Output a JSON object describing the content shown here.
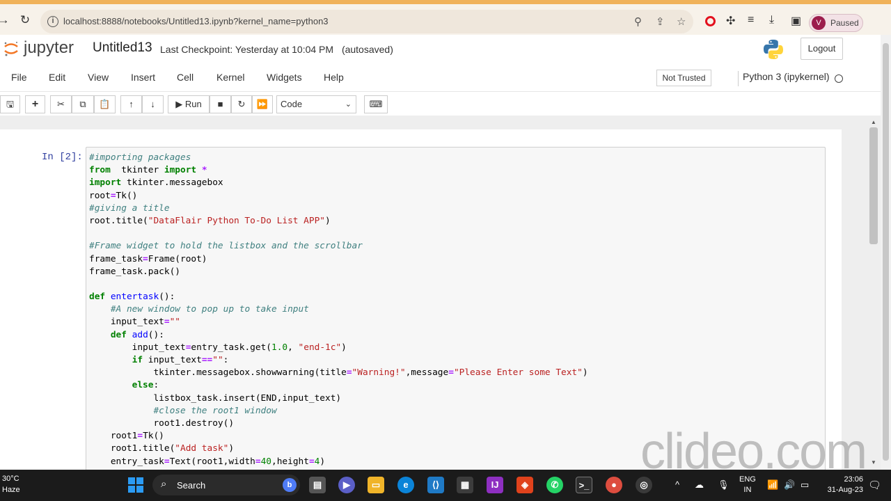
{
  "browser": {
    "url": "localhost:8888/notebooks/Untitled13.ipynb?kernel_name=python3",
    "profile_initial": "V",
    "profile_status": "Paused"
  },
  "header": {
    "logo_text": "jupyter",
    "notebook_title": "Untitled13",
    "checkpoint": "Last Checkpoint: Yesterday at 10:04 PM",
    "autosaved": "(autosaved)",
    "logout_label": "Logout"
  },
  "menu": {
    "items": [
      "File",
      "Edit",
      "View",
      "Insert",
      "Cell",
      "Kernel",
      "Widgets",
      "Help"
    ],
    "trust_label": "Not Trusted",
    "kernel_label": "Python 3 (ipykernel)"
  },
  "toolbar": {
    "run_label": "Run",
    "cell_type": "Code"
  },
  "cell": {
    "prompt": "In [2]:"
  },
  "watermark": "clideo.com",
  "taskbar": {
    "temperature": "30°C",
    "weather": "Haze",
    "search_label": "Search",
    "language_top": "ENG",
    "language_bottom": "IN",
    "time": "23:06",
    "date": "31-Aug-23"
  },
  "colors": {
    "prompt": "#303f9f",
    "keyword": "#008000",
    "comment": "#408080",
    "string": "#ba2121",
    "function": "#0000ff",
    "browser_accent": "#f0b25a"
  }
}
